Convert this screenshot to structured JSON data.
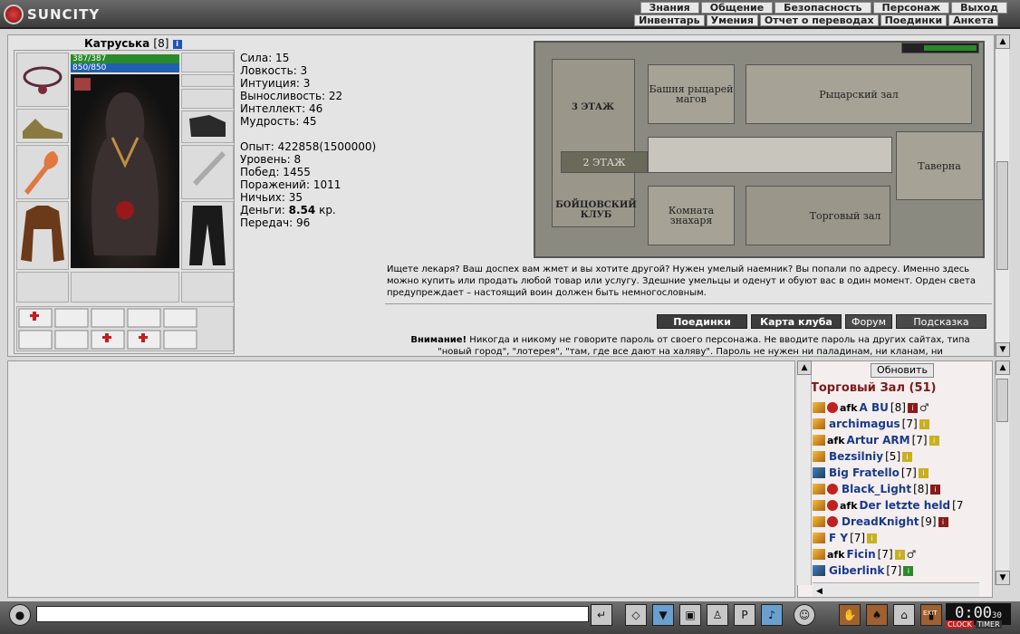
{
  "app": {
    "logo": "SUNCITY"
  },
  "menu_top": [
    "Знания",
    "Общение",
    "Безопасность",
    "Персонаж",
    "Выход"
  ],
  "menu_sub": [
    "Инвентарь",
    "Умения",
    "Отчет о переводах",
    "Поединки",
    "Анкета"
  ],
  "character": {
    "name": "Катруська",
    "level": "[8]",
    "hp": "387/387",
    "mp": "850/850"
  },
  "stats": {
    "strength": "Сила: 15",
    "agility": "Ловкость: 3",
    "intuition": "Интуиция: 3",
    "endurance": "Выносливость: 22",
    "intellect": "Интеллект: 46",
    "wisdom": "Мудрость: 45",
    "exp": "Опыт: 422858(1500000)",
    "level": "Уровень: 8",
    "wins": "Побед: 1455",
    "losses": "Поражений: 1011",
    "draws": "Ничьих: 35",
    "money_label": "Деньги: ",
    "money_value": "8.54",
    "money_unit": " кр.",
    "transfers": "Передач: 96"
  },
  "map": {
    "floor3": "3 ЭТАЖ",
    "floor2": "2 ЭТАЖ",
    "club": "БОЙЦОВСКИЙ КЛУБ",
    "tower": "Башня рыцарей магов",
    "knight_hall": "Рыцарский зал",
    "tavern": "Таверна",
    "healer": "Комната знахаря",
    "trade_hall": "Торговый зал"
  },
  "description": "Ищете лекаря? Ваш доспех вам жмет и вы хотите другой? Нужен умелый наемник? Вы попали по адресу. Именно здесь можно купить или продать любой товар или услугу. Здешние умельцы и оденут и обуют вас в один момент. Орден света предупреждает – настоящий воин должен быть немногословным.",
  "buttons": {
    "duels": "Поединки",
    "club_map": "Карта клуба",
    "forum": "Форум",
    "hint": "Подсказка"
  },
  "warning": {
    "label": "Внимание!",
    "line1": "Никогда и никому не говорите пароль от своего персонажа. Не вводите пароль на других сайтах, типа",
    "line2": "\"новый город\", \"лотерея\", \"там, где все дают на халяву\". Пароль не нужен ни паладинам, ни кланам, ни"
  },
  "userlist": {
    "refresh": "Обновить",
    "room": "Торговый Зал (51)",
    "users": [
      {
        "afk": "afk",
        "nick": "A BU",
        "lvl": "[8]"
      },
      {
        "afk": "",
        "nick": "archimagus",
        "lvl": "[7]"
      },
      {
        "afk": "afk",
        "nick": "Artur ARM",
        "lvl": "[7]"
      },
      {
        "afk": "",
        "nick": "Bezsilniy",
        "lvl": "[5]"
      },
      {
        "afk": "",
        "nick": "Big Fratello",
        "lvl": "[7]"
      },
      {
        "afk": "",
        "nick": "Black_Light",
        "lvl": "[8]"
      },
      {
        "afk": "afk",
        "nick": "Der letzte held",
        "lvl": "[7"
      },
      {
        "afk": "",
        "nick": "DreadKnight",
        "lvl": "[9]"
      },
      {
        "afk": "",
        "nick": "F Y",
        "lvl": "[7]"
      },
      {
        "afk": "afk",
        "nick": "Ficin",
        "lvl": "[7]"
      },
      {
        "afk": "",
        "nick": "Giberlink",
        "lvl": "[7]"
      }
    ]
  },
  "clock": {
    "time": "0:00",
    "sub": "30",
    "clock_label": "CLOCK",
    "timer_label": "TIMER",
    "exit": "EXIT"
  }
}
